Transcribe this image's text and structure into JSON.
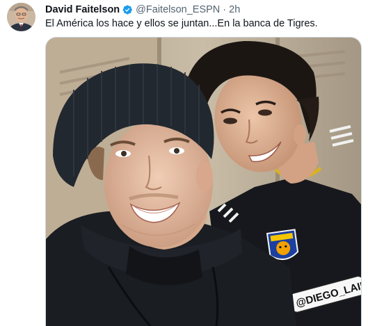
{
  "tweet": {
    "author_name": "David Faitelson",
    "handle": "@Faitelson_ESPN",
    "separator": "·",
    "time": "2h",
    "text": "El América los hace y ellos se juntan...En la banca de Tigres.",
    "verified": true
  },
  "media": {
    "name_tag": "@DIEGO_LAIN"
  },
  "colors": {
    "text": "#0f1419",
    "secondary": "#536471",
    "verified": "#1d9bf0"
  },
  "icons": {
    "verified": "verified-badge-icon"
  }
}
